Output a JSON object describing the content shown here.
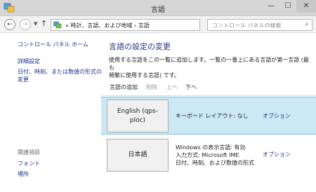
{
  "window": {
    "title": "言語",
    "minimize": "—",
    "maximize": "☐",
    "close": "✕",
    "app_icon": "language-icon"
  },
  "addressbar": {
    "back": "←",
    "forward": "→",
    "up": "↑",
    "path": "« 時計、言語、および地域 › 言語",
    "refresh": "↻",
    "search_placeholder": "コントロール パネルの検索",
    "search_icon": "search-icon"
  },
  "left_pane": {
    "home": "コントロール パネル ホーム",
    "links": [
      "詳細設定",
      "日付、時刻、または数値の形式の",
      "変更"
    ],
    "see_also": "関連項目",
    "related": [
      "フォント",
      "場所"
    ]
  },
  "main": {
    "heading": "言語の設定の変更",
    "description_line1": "使用する言語をこの一覧に追加します。一覧の一番上にある言語が第一言語 (最も",
    "description_line2": "頻繁に使用する言語) です。",
    "toolbar": {
      "add": "言語の追加",
      "remove": "削除",
      "up": "上へ",
      "down": "下へ"
    },
    "languages": [
      {
        "name_line1": "English (qps-",
        "name_line2": "ploc)",
        "info_line1": "キーボード レイアウト: なし",
        "options": "オプション",
        "selected": true
      },
      {
        "name_line1": "日本語",
        "info_line1": "Windows の表示言語: 有効",
        "info_line2": "入力方式: Microsoft IME",
        "info_line3": "日付、時刻、および数値の形式",
        "options": "オプション",
        "selected": false
      }
    ]
  },
  "colors": {
    "link": "#1e3287",
    "selection": "#cce8f4",
    "selection_border": "#7dc4e4",
    "titlebar": "#d6d6d6"
  }
}
